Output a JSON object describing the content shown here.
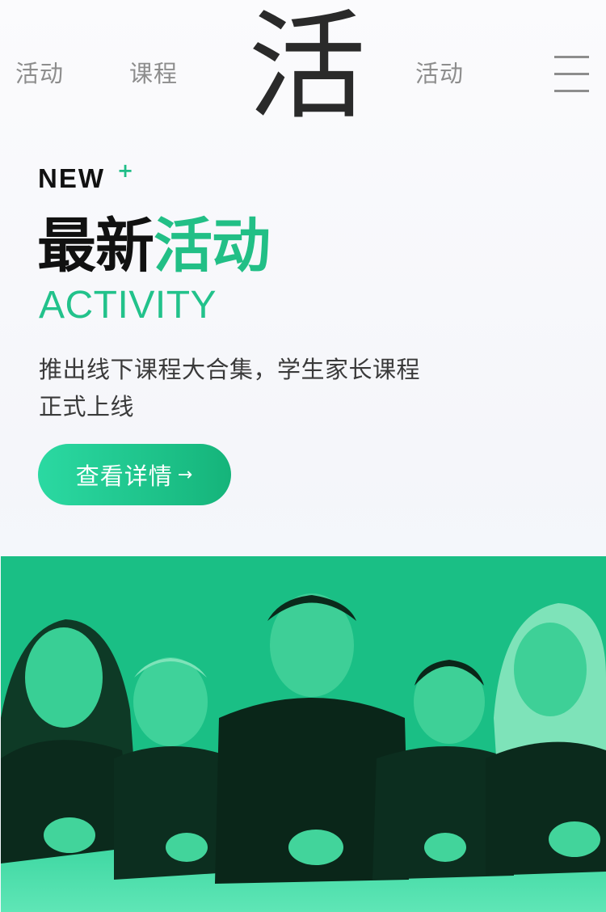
{
  "nav": {
    "left_links": [
      "活动",
      "课程"
    ],
    "right_link": "活动",
    "logo_char": "活"
  },
  "hero": {
    "tag": "NEW",
    "tag_mark": "+",
    "title_dark": "最新",
    "title_accent": "活动",
    "subtitle": "ACTIVITY",
    "description_line1": "推出线下课程大合集，学生家长课程",
    "description_line2": "正式上线",
    "cta_label": "查看详情",
    "cta_arrow": "→"
  },
  "colors": {
    "accent": "#22bf86",
    "photo_tint": "#1abf85",
    "button_gradient_start": "#2bd9a2",
    "button_gradient_end": "#15b47a"
  },
  "icons": {
    "menu": "hamburger-icon",
    "cta": "arrow-right-icon"
  }
}
